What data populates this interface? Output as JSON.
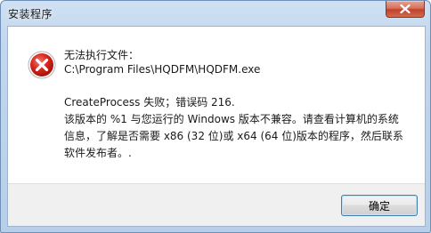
{
  "window": {
    "title": "安装程序"
  },
  "message": {
    "line1": "无法执行文件：",
    "line2": "C:\\Program Files\\HQDFM\\HQDFM.exe",
    "line3": "CreateProcess 失败；错误码 216.",
    "line4": "该版本的 %1 与您运行的 Windows 版本不兼容。请查看计算机的系统",
    "line5": "信息，了解是否需要 x86 (32 位)或 x64 (64 位)版本的程序，然后联系",
    "line6": "软件发布者。."
  },
  "buttons": {
    "ok_label": "确定"
  },
  "icons": {
    "error": "error-icon",
    "close": "close-icon"
  },
  "colors": {
    "error_red": "#d9261c",
    "close_button": "#c2412b"
  }
}
